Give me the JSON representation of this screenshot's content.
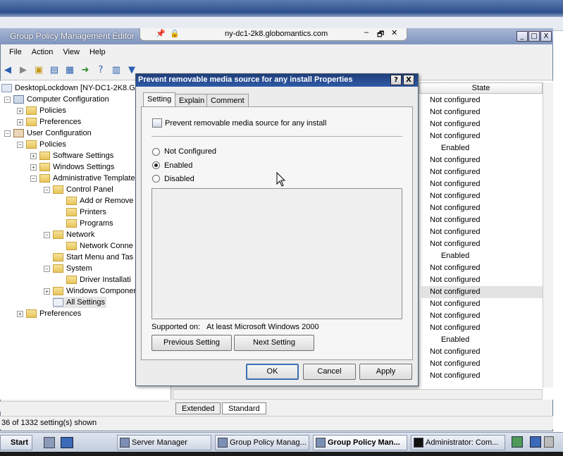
{
  "rdp": {
    "host": "ny-dc1-2k8.globomantics.com",
    "btn_min": "–",
    "btn_restore": "🗗",
    "btn_close": "✕"
  },
  "window": {
    "title": "Group Policy Management Editor",
    "btn_min": "_",
    "btn_max": "□",
    "btn_close": "X"
  },
  "menu": [
    "File",
    "Action",
    "View",
    "Help"
  ],
  "tree": {
    "root": "DesktopLockdown [NY-DC1-2K8.GL",
    "computer_config": "Computer Configuration",
    "cc_policies": "Policies",
    "cc_preferences": "Preferences",
    "user_config": "User Configuration",
    "uc_policies": "Policies",
    "software_settings": "Software Settings",
    "windows_settings": "Windows Settings",
    "admin_templates": "Administrative Template",
    "control_panel": "Control Panel",
    "add_remove": "Add or Remove",
    "printers": "Printers",
    "programs": "Programs",
    "network": "Network",
    "network_conn": "Network Conne",
    "start_menu": "Start Menu and Tas",
    "system": "System",
    "driver_install": "Driver Installati",
    "windows_components": "Windows Componen",
    "all_settings": "All Settings",
    "uc_preferences": "Preferences"
  },
  "list": {
    "state_header": "State",
    "states": [
      "Not configured",
      "Not configured",
      "Not configured",
      "Not configured",
      "Enabled",
      "Not configured",
      "Not configured",
      "Not configured",
      "Not configured",
      "Not configured",
      "Not configured",
      "Not configured",
      "Not configured",
      "Enabled",
      "Not configured",
      "Not configured",
      "Not configured",
      "Not configured",
      "Not configured",
      "Not configured",
      "Enabled",
      "Not configured",
      "Not configured",
      "Not configured"
    ]
  },
  "bottom_tabs": {
    "extended": "Extended",
    "standard": "Standard"
  },
  "status": "36 of 1332 setting(s) shown",
  "dialog": {
    "title": "Prevent removable media source for any install Properties",
    "help_btn": "?",
    "close_btn": "X",
    "tabs": {
      "setting": "Setting",
      "explain": "Explain",
      "comment": "Comment"
    },
    "policy_name": "Prevent removable media source for any install",
    "options": {
      "not_configured": "Not Configured",
      "enabled": "Enabled",
      "disabled": "Disabled"
    },
    "selected": "Enabled",
    "supported_label": "Supported on:",
    "supported_value": "At least Microsoft Windows 2000",
    "prev_btn": "Previous Setting",
    "next_btn": "Next Setting",
    "ok": "OK",
    "cancel": "Cancel",
    "apply": "Apply"
  },
  "taskbar": {
    "start": "Start",
    "tasks": {
      "server_manager": "Server Manager",
      "gpm": "Group Policy Manag...",
      "gpme": "Group Policy Man...",
      "admin": "Administrator: Com..."
    }
  }
}
